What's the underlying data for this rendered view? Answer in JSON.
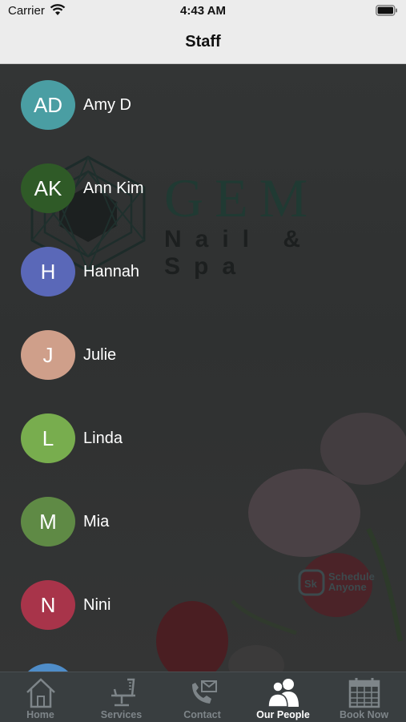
{
  "status_bar": {
    "carrier": "Carrier",
    "time": "4:43 AM"
  },
  "nav": {
    "title": "Staff"
  },
  "background": {
    "logo_title": "GEM",
    "logo_subtitle": "Nail & Spa",
    "watermark_line1": "Schedule",
    "watermark_line2": "Anyone"
  },
  "staff": [
    {
      "initials": "AD",
      "name": "Amy D",
      "color": "#4a9ea3"
    },
    {
      "initials": "AK",
      "name": "Ann Kim",
      "color": "#2f5a27"
    },
    {
      "initials": "H",
      "name": "Hannah",
      "color": "#5a68b8"
    },
    {
      "initials": "J",
      "name": "Julie",
      "color": "#cf9f8a"
    },
    {
      "initials": "L",
      "name": "Linda",
      "color": "#78ad4e"
    },
    {
      "initials": "M",
      "name": "Mia",
      "color": "#5f8a45"
    },
    {
      "initials": "N",
      "name": "Nini",
      "color": "#a8344a"
    },
    {
      "initials": "",
      "name": "",
      "color": "#4f8dc9"
    }
  ],
  "tabs": [
    {
      "label": "Home",
      "icon": "house-icon"
    },
    {
      "label": "Services",
      "icon": "barber-chair-icon"
    },
    {
      "label": "Contact",
      "icon": "phone-envelope-icon"
    },
    {
      "label": "Our People",
      "icon": "people-icon"
    },
    {
      "label": "Book Now",
      "icon": "calendar-icon"
    }
  ]
}
